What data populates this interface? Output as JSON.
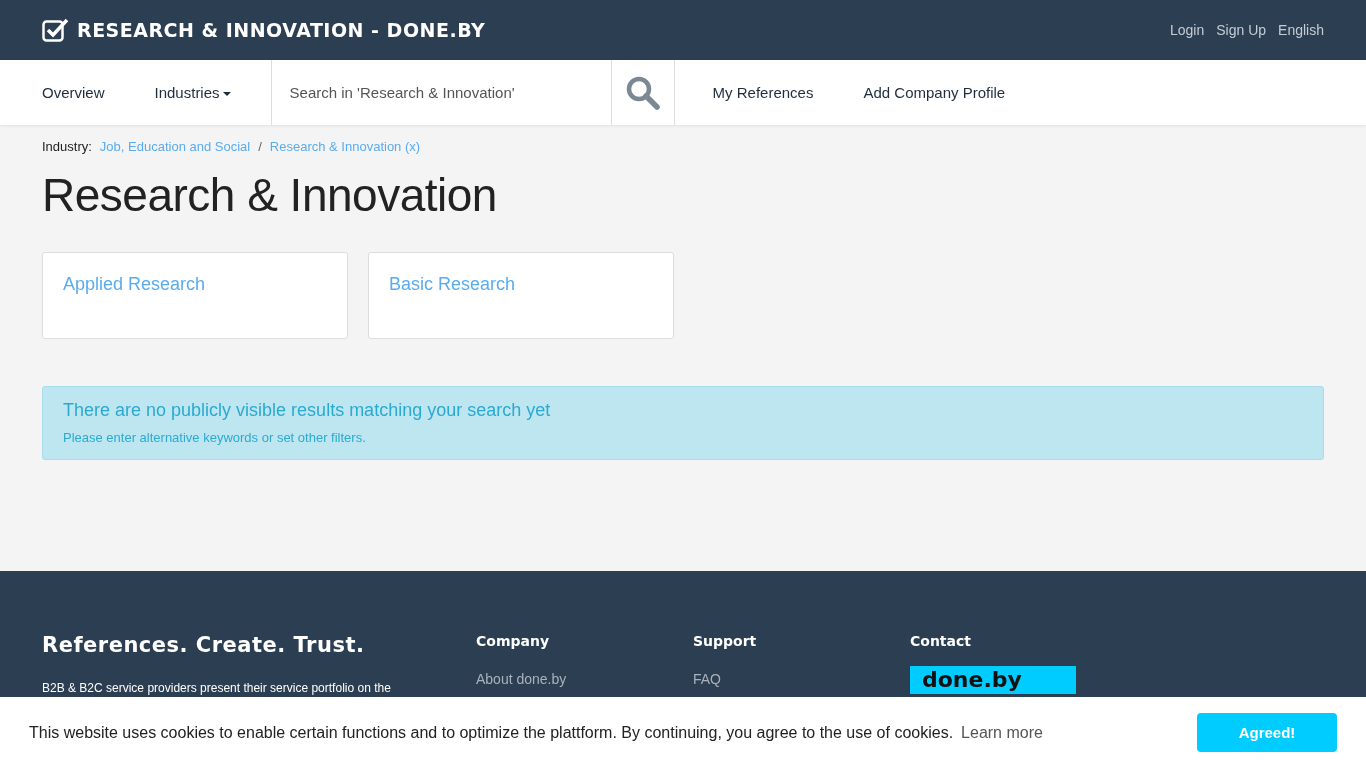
{
  "header": {
    "title": "RESEARCH & INNOVATION - DONE.BY",
    "links": [
      "Login",
      "Sign Up",
      "English"
    ]
  },
  "nav": {
    "items": [
      {
        "label": "Overview",
        "kind": "link"
      },
      {
        "label": "Industries",
        "kind": "dropdown"
      }
    ],
    "search": {
      "placeholder": "Search in 'Research & Innovation'"
    },
    "actions": [
      "My References",
      "Add Company Profile"
    ]
  },
  "breadcrumb": {
    "label": "Industry:",
    "separator": "/",
    "items": [
      "Job, Education and Social",
      "Research & Innovation (x)"
    ]
  },
  "page_title": "Research & Innovation",
  "categories": [
    "Applied Research",
    "Basic Research"
  ],
  "alert": {
    "title": "There are no publicly visible results matching your search yet",
    "text": "Please enter alternative keywords or set other filters."
  },
  "footer": {
    "slogan": "References. Create. Trust.",
    "text": "B2B & B2C service providers present their service portfolio on the",
    "columns": [
      {
        "heading": "Company",
        "kind": "links",
        "links": [
          "About done.by"
        ]
      },
      {
        "heading": "Support",
        "kind": "links",
        "links": [
          "FAQ"
        ]
      },
      {
        "heading": "Contact",
        "kind": "logo",
        "logo": "done.by"
      }
    ]
  },
  "cookie": {
    "text": "This website uses cookies to enable certain functions and to optimize the plattform. By continuing, you agree to the use of cookies.",
    "link": "Learn more",
    "button": "Agreed!"
  }
}
